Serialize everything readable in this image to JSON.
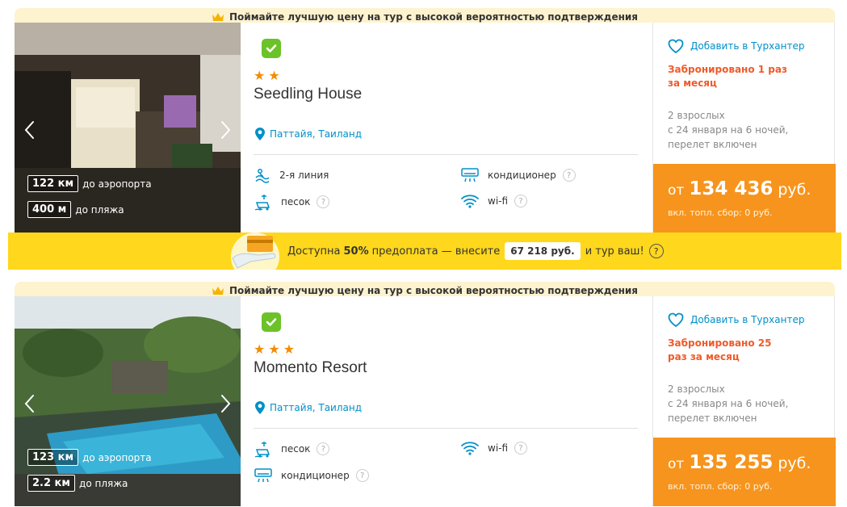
{
  "banner_text": "Поймайте лучшую цену на тур с высокой вероятностью подтверждения",
  "colors": {
    "accent": "#f7941d",
    "link": "#0090c8",
    "booked": "#f05a28",
    "prepay_bg": "#ffd71c"
  },
  "hotels": [
    {
      "name": "Seedling House",
      "stars": "★★",
      "location": "Паттайя, Таиланд",
      "distances": [
        {
          "value": "122 км",
          "label": "до аэропорта"
        },
        {
          "value": "400 м",
          "label": "до пляжа"
        }
      ],
      "features": [
        {
          "icon": "beach-line-icon",
          "label": "2-я линия",
          "help": false
        },
        {
          "icon": "air-conditioner-icon",
          "label": "кондиционер",
          "help": true
        },
        {
          "icon": "sand-icon",
          "label": "песок",
          "help": true
        },
        {
          "icon": "wifi-icon",
          "label": "wi-fi",
          "help": true
        }
      ],
      "wishlist": "Добавить в Турхантер",
      "booked": "Забронировано 1 раз за месяц",
      "tour_info": [
        "2 взрослых",
        "с 24 января на 6 ночей,",
        "перелет включен"
      ],
      "price_from": "от",
      "price": "134 436",
      "currency": "руб.",
      "fuel": "вкл. топл. сбор: 0 руб."
    },
    {
      "name": "Momento Resort",
      "stars": "★★★",
      "location": "Паттайя, Таиланд",
      "distances": [
        {
          "value": "123 км",
          "label": "до аэропорта"
        },
        {
          "value": "2.2 км",
          "label": "до пляжа"
        }
      ],
      "features": [
        {
          "icon": "sand-icon",
          "label": "песок",
          "help": true
        },
        {
          "icon": "wifi-icon",
          "label": "wi-fi",
          "help": true
        },
        {
          "icon": "air-conditioner-icon",
          "label": "кондиционер",
          "help": true
        }
      ],
      "wishlist": "Добавить в Турхантер",
      "booked": "Забронировано 25 раз за месяц",
      "tour_info": [
        "2 взрослых",
        "с 24 января на 6 ночей,",
        "перелет включен"
      ],
      "price_from": "от",
      "price": "135 255",
      "currency": "руб.",
      "fuel": "вкл. топл. сбор: 0 руб."
    }
  ],
  "prepay": {
    "text_before": "Доступна",
    "percent": "50%",
    "text_middle": "предоплата — внесите",
    "amount": "67 218 руб.",
    "text_after": "и тур ваш!",
    "help": "?"
  },
  "help_mark": "?"
}
